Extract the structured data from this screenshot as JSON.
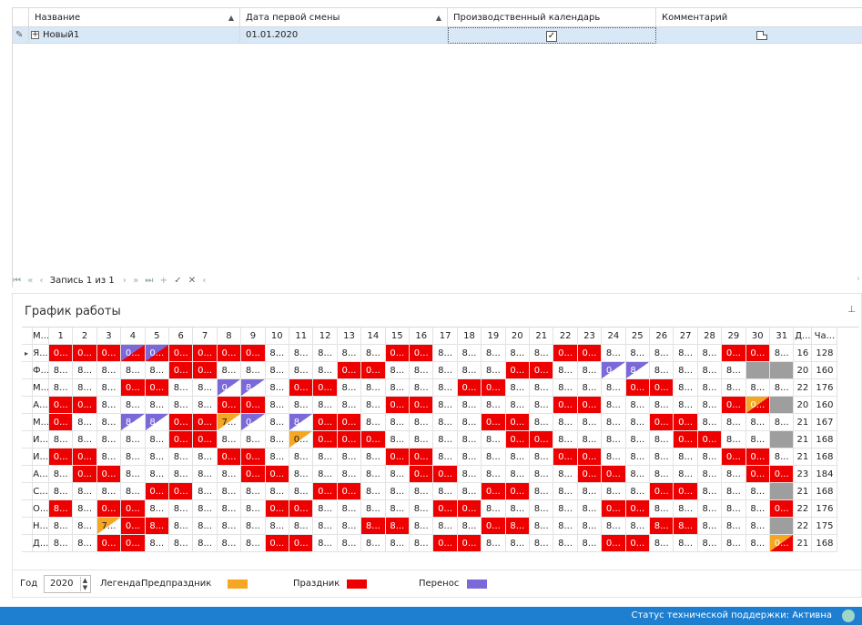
{
  "top_grid": {
    "columns": [
      {
        "label": "Название",
        "sort": "▲"
      },
      {
        "label": "Дата первой смены",
        "sort": "▲"
      },
      {
        "label": "Производственный календарь",
        "sort": ""
      },
      {
        "label": "Комментарий",
        "sort": ""
      }
    ],
    "row": {
      "name": "Новый1",
      "first_shift_date": "01.01.2020",
      "production_calendar": true,
      "edit_icon": "pencil-icon",
      "expand_icon": "plus-icon",
      "comment_icon": "note-icon"
    },
    "navigator": {
      "record_text": "Запись 1 из 1",
      "buttons": [
        "first",
        "prev-page",
        "prev",
        "next",
        "next-page",
        "last",
        "append",
        "apply",
        "cancel",
        "more"
      ]
    }
  },
  "schedule": {
    "title": "График работы",
    "pin_icon": "pin-icon",
    "headers": [
      "М...",
      "1",
      "2",
      "3",
      "4",
      "5",
      "6",
      "7",
      "8",
      "9",
      "10",
      "11",
      "12",
      "13",
      "14",
      "15",
      "16",
      "17",
      "18",
      "19",
      "20",
      "21",
      "22",
      "23",
      "24",
      "25",
      "26",
      "27",
      "28",
      "29",
      "30",
      "31",
      "Д...",
      "Ча..."
    ],
    "rows": [
      {
        "month": "Я...",
        "cells": [
          "0...",
          "0...",
          "0...",
          "0...",
          "0...",
          "0...",
          "0...",
          "0...",
          "0...",
          "8...",
          "8...",
          "8...",
          "8...",
          "8...",
          "0...",
          "0...",
          "8...",
          "8...",
          "8...",
          "8...",
          "8...",
          "0...",
          "0...",
          "8...",
          "8...",
          "8...",
          "8...",
          "8...",
          "0...",
          "0...",
          "8..."
        ],
        "types": [
          "h",
          "h",
          "h",
          "pr",
          "pr",
          "h",
          "h",
          "h",
          "h",
          "n",
          "n",
          "n",
          "n",
          "n",
          "h",
          "h",
          "n",
          "n",
          "n",
          "n",
          "n",
          "h",
          "h",
          "n",
          "n",
          "n",
          "n",
          "n",
          "h",
          "h",
          "n"
        ],
        "days": "16",
        "hours": "128"
      },
      {
        "month": "Ф...",
        "cells": [
          "8...",
          "8...",
          "8...",
          "8...",
          "8...",
          "0...",
          "0...",
          "8...",
          "8...",
          "8...",
          "8...",
          "8...",
          "0...",
          "0...",
          "8...",
          "8...",
          "8...",
          "8...",
          "8...",
          "0...",
          "0...",
          "8...",
          "8...",
          "0...",
          "8...",
          "8...",
          "8...",
          "8...",
          "8...",
          "",
          ""
        ],
        "types": [
          "n",
          "n",
          "n",
          "n",
          "n",
          "h",
          "h",
          "n",
          "n",
          "n",
          "n",
          "n",
          "h",
          "h",
          "n",
          "n",
          "n",
          "n",
          "n",
          "h",
          "h",
          "n",
          "n",
          "p",
          "p",
          "n",
          "n",
          "n",
          "n",
          "g",
          "g"
        ],
        "days": "20",
        "hours": "160"
      },
      {
        "month": "М...",
        "cells": [
          "8...",
          "8...",
          "8...",
          "0...",
          "0...",
          "8...",
          "8...",
          "0...",
          "8...",
          "8...",
          "0...",
          "0...",
          "8...",
          "8...",
          "8...",
          "8...",
          "8...",
          "0...",
          "0...",
          "8...",
          "8...",
          "8...",
          "8...",
          "8...",
          "0...",
          "0...",
          "8...",
          "8...",
          "8...",
          "8...",
          "8..."
        ],
        "types": [
          "n",
          "n",
          "n",
          "h",
          "h",
          "n",
          "n",
          "p",
          "p",
          "n",
          "h",
          "h",
          "n",
          "n",
          "n",
          "n",
          "n",
          "h",
          "h",
          "n",
          "n",
          "n",
          "n",
          "n",
          "h",
          "h",
          "n",
          "n",
          "n",
          "n",
          "n"
        ],
        "days": "22",
        "hours": "176"
      },
      {
        "month": "А...",
        "cells": [
          "0...",
          "0...",
          "8...",
          "8...",
          "8...",
          "8...",
          "8...",
          "0...",
          "0...",
          "8...",
          "8...",
          "8...",
          "8...",
          "8...",
          "0...",
          "0...",
          "8...",
          "8...",
          "8...",
          "8...",
          "8...",
          "0...",
          "0...",
          "8...",
          "8...",
          "8...",
          "8...",
          "8...",
          "0...",
          "0...",
          ""
        ],
        "types": [
          "h",
          "h",
          "n",
          "n",
          "n",
          "n",
          "n",
          "h",
          "h",
          "n",
          "n",
          "n",
          "n",
          "n",
          "h",
          "h",
          "n",
          "n",
          "n",
          "n",
          "n",
          "h",
          "h",
          "n",
          "n",
          "n",
          "n",
          "n",
          "h",
          "or",
          "g"
        ],
        "days": "20",
        "hours": "160"
      },
      {
        "month": "М...",
        "cells": [
          "0...",
          "8...",
          "8...",
          "8...",
          "8...",
          "0...",
          "0...",
          "7...",
          "0...",
          "8...",
          "8...",
          "0...",
          "0...",
          "8...",
          "8...",
          "8...",
          "8...",
          "8...",
          "0...",
          "0...",
          "8...",
          "8...",
          "8...",
          "8...",
          "8...",
          "0...",
          "0...",
          "8...",
          "8...",
          "8...",
          "8..."
        ],
        "types": [
          "h",
          "n",
          "n",
          "p",
          "p",
          "h",
          "h",
          "o",
          "p",
          "n",
          "p",
          "h",
          "h",
          "n",
          "n",
          "n",
          "n",
          "n",
          "h",
          "h",
          "n",
          "n",
          "n",
          "n",
          "n",
          "h",
          "h",
          "n",
          "n",
          "n",
          "n"
        ],
        "days": "21",
        "hours": "167"
      },
      {
        "month": "И...",
        "cells": [
          "8...",
          "8...",
          "8...",
          "8...",
          "8...",
          "0...",
          "0...",
          "8...",
          "8...",
          "8...",
          "0...",
          "0...",
          "0...",
          "0...",
          "8...",
          "8...",
          "8...",
          "8...",
          "8...",
          "0...",
          "0...",
          "8...",
          "8...",
          "8...",
          "8...",
          "8...",
          "0...",
          "0...",
          "8...",
          "8...",
          ""
        ],
        "types": [
          "n",
          "n",
          "n",
          "n",
          "n",
          "h",
          "h",
          "n",
          "n",
          "n",
          "o",
          "h",
          "h",
          "h",
          "n",
          "n",
          "n",
          "n",
          "n",
          "h",
          "h",
          "n",
          "n",
          "n",
          "n",
          "n",
          "h",
          "h",
          "n",
          "n",
          "g"
        ],
        "days": "21",
        "hours": "168"
      },
      {
        "month": "И...",
        "cells": [
          "0...",
          "0...",
          "8...",
          "8...",
          "8...",
          "8...",
          "8...",
          "0...",
          "0...",
          "8...",
          "8...",
          "8...",
          "8...",
          "8...",
          "0...",
          "0...",
          "8...",
          "8...",
          "8...",
          "8...",
          "8...",
          "0...",
          "0...",
          "8...",
          "8...",
          "8...",
          "8...",
          "8...",
          "0...",
          "0...",
          "8..."
        ],
        "types": [
          "h",
          "h",
          "n",
          "n",
          "n",
          "n",
          "n",
          "h",
          "h",
          "n",
          "n",
          "n",
          "n",
          "n",
          "h",
          "h",
          "n",
          "n",
          "n",
          "n",
          "n",
          "h",
          "h",
          "n",
          "n",
          "n",
          "n",
          "n",
          "h",
          "h",
          "n"
        ],
        "days": "21",
        "hours": "168"
      },
      {
        "month": "А...",
        "cells": [
          "8...",
          "0...",
          "0...",
          "8...",
          "8...",
          "8...",
          "8...",
          "8...",
          "0...",
          "0...",
          "8...",
          "8...",
          "8...",
          "8...",
          "8...",
          "0...",
          "0...",
          "8...",
          "8...",
          "8...",
          "8...",
          "8...",
          "0...",
          "0...",
          "8...",
          "8...",
          "8...",
          "8...",
          "8...",
          "0...",
          "0..."
        ],
        "types": [
          "n",
          "h",
          "h",
          "n",
          "n",
          "n",
          "n",
          "n",
          "h",
          "h",
          "n",
          "n",
          "n",
          "n",
          "n",
          "h",
          "h",
          "n",
          "n",
          "n",
          "n",
          "n",
          "h",
          "h",
          "n",
          "n",
          "n",
          "n",
          "n",
          "h",
          "h"
        ],
        "days": "23",
        "hours": "184"
      },
      {
        "month": "С...",
        "cells": [
          "8...",
          "8...",
          "8...",
          "8...",
          "0...",
          "0...",
          "8...",
          "8...",
          "8...",
          "8...",
          "8...",
          "0...",
          "0...",
          "8...",
          "8...",
          "8...",
          "8...",
          "8...",
          "0...",
          "0...",
          "8...",
          "8...",
          "8...",
          "8...",
          "8...",
          "0...",
          "0...",
          "8...",
          "8...",
          "8...",
          ""
        ],
        "types": [
          "n",
          "n",
          "n",
          "n",
          "h",
          "h",
          "n",
          "n",
          "n",
          "n",
          "n",
          "h",
          "h",
          "n",
          "n",
          "n",
          "n",
          "n",
          "h",
          "h",
          "n",
          "n",
          "n",
          "n",
          "n",
          "h",
          "h",
          "n",
          "n",
          "n",
          "g"
        ],
        "days": "21",
        "hours": "168"
      },
      {
        "month": "О...",
        "cells": [
          "8...",
          "8...",
          "0...",
          "0...",
          "8...",
          "8...",
          "8...",
          "8...",
          "8...",
          "0...",
          "0...",
          "8...",
          "8...",
          "8...",
          "8...",
          "8...",
          "0...",
          "0...",
          "8...",
          "8...",
          "8...",
          "8...",
          "8...",
          "0...",
          "0...",
          "8...",
          "8...",
          "8...",
          "8...",
          "8...",
          "0..."
        ],
        "types": [
          "h",
          "n",
          "h",
          "h",
          "n",
          "n",
          "n",
          "n",
          "n",
          "h",
          "h",
          "n",
          "n",
          "n",
          "n",
          "n",
          "h",
          "h",
          "n",
          "n",
          "n",
          "n",
          "n",
          "h",
          "h",
          "n",
          "n",
          "n",
          "n",
          "n",
          "h"
        ],
        "days": "22",
        "hours": "176"
      },
      {
        "month": "Н...",
        "cells": [
          "8...",
          "8...",
          "7...",
          "0...",
          "8...",
          "8...",
          "8...",
          "8...",
          "8...",
          "8...",
          "8...",
          "8...",
          "8...",
          "8...",
          "8...",
          "8...",
          "8...",
          "8...",
          "0...",
          "8...",
          "8...",
          "8...",
          "8...",
          "8...",
          "8...",
          "8...",
          "8...",
          "8...",
          "8...",
          "8...",
          ""
        ],
        "types": [
          "n",
          "n",
          "o",
          "h",
          "h",
          "n",
          "n",
          "n",
          "n",
          "n",
          "n",
          "n",
          "n",
          "h",
          "h",
          "n",
          "n",
          "n",
          "h",
          "h",
          "n",
          "n",
          "n",
          "n",
          "n",
          "h",
          "h",
          "n",
          "n",
          "n",
          "g"
        ],
        "days": "22",
        "hours": "175"
      },
      {
        "month": "Д...",
        "cells": [
          "8...",
          "8...",
          "0...",
          "0...",
          "8...",
          "8...",
          "8...",
          "8...",
          "8...",
          "0...",
          "0...",
          "8...",
          "8...",
          "8...",
          "8...",
          "8...",
          "0...",
          "0...",
          "8...",
          "8...",
          "8...",
          "8...",
          "8...",
          "0...",
          "0...",
          "8...",
          "8...",
          "8...",
          "8...",
          "8...",
          "0..."
        ],
        "types": [
          "n",
          "n",
          "h",
          "h",
          "n",
          "n",
          "n",
          "n",
          "n",
          "h",
          "h",
          "n",
          "n",
          "n",
          "n",
          "n",
          "h",
          "h",
          "n",
          "n",
          "n",
          "n",
          "n",
          "h",
          "h",
          "n",
          "n",
          "n",
          "n",
          "n",
          "or"
        ],
        "days": "21",
        "hours": "168"
      }
    ],
    "year_label": "Год",
    "year_value": "2020",
    "legend_label": "Легенда:",
    "legend": [
      {
        "label": "Предпраздник",
        "color": "#f5a623"
      },
      {
        "label": "Праздник",
        "color": "#ee0000"
      },
      {
        "label": "Перенос",
        "color": "#7b68d9"
      }
    ]
  },
  "status": {
    "text": "Статус технической поддержки: Активна",
    "indicator_color": "#9ed6c8"
  }
}
